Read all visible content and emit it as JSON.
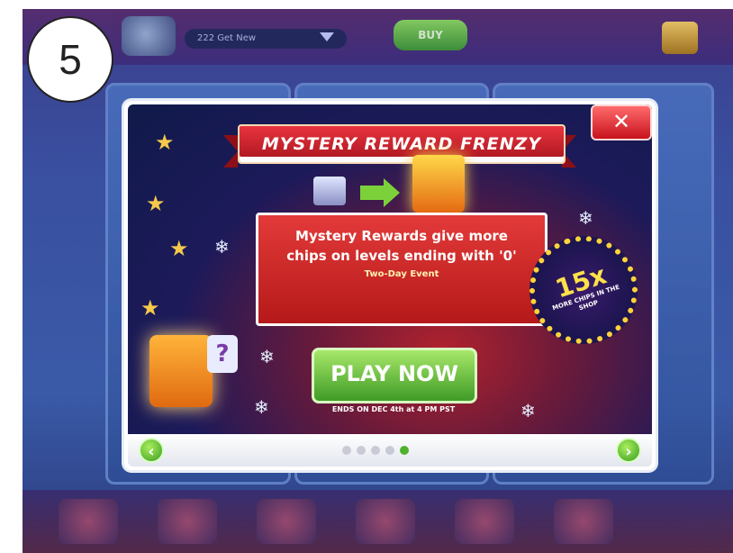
{
  "step": {
    "number": "5"
  },
  "background": {
    "chip_label": "222 Get New",
    "buy_label": "BUY"
  },
  "modal": {
    "banner_title": "MYSTERY REWARD FRENZY",
    "close_label": "✕",
    "message": "Mystery Rewards give more chips on levels ending with '0'",
    "sub_message": "Two-Day Event",
    "ring_multiplier": "15x",
    "ring_caption": "MORE CHIPS IN THE SHOP",
    "play_button": "PLAY NOW",
    "ends_text": "ENDS ON DEC 4th at 4 PM PST",
    "nav_prev": "‹",
    "nav_next": "›",
    "pager": {
      "total": 5,
      "active_index": 4
    }
  },
  "colors": {
    "banner": "#d22a33",
    "play": "#5fbf34",
    "close": "#e02a2f"
  },
  "icons": {
    "close": "close-icon",
    "prev": "chevron-left-icon",
    "next": "chevron-right-icon"
  }
}
